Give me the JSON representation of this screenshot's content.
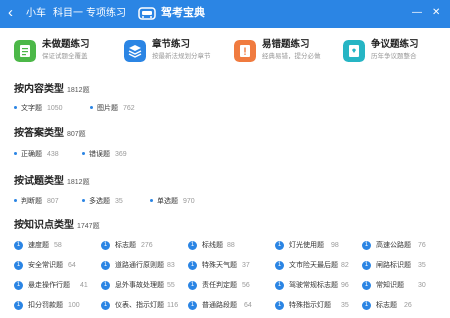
{
  "header": {
    "back_symbol": "‹",
    "crumbs": [
      "小车",
      "科目一",
      "专项练习"
    ],
    "brand": "驾考宝典",
    "window_controls": {
      "minimize": "—",
      "close": "✕"
    },
    "bg_color": "#2b85e4"
  },
  "cards": [
    {
      "title": "未做题练习",
      "subtitle": "保证试题全覆盖",
      "color": "#4cb848",
      "icon": "clipboard-icon"
    },
    {
      "title": "章节练习",
      "subtitle": "按最新法规划分章节",
      "color": "#2b85e4",
      "icon": "layers-icon"
    },
    {
      "title": "易错题练习",
      "subtitle": "经典易错，提分必做",
      "color": "#f07b3f",
      "icon": "warning-clipboard-icon"
    },
    {
      "title": "争议题练习",
      "subtitle": "历年争议题整合",
      "color": "#26b5c4",
      "icon": "dispute-clipboard-icon"
    }
  ],
  "sections": {
    "content": {
      "title": "按内容类型",
      "count": "1812题",
      "items": [
        {
          "label": "文字题",
          "count": "1050"
        },
        {
          "label": "图片题",
          "count": "762"
        }
      ]
    },
    "answer": {
      "title": "按答案类型",
      "count": "807题",
      "items": [
        {
          "label": "正确题",
          "count": "438"
        },
        {
          "label": "错误题",
          "count": "369"
        }
      ]
    },
    "question": {
      "title": "按试题类型",
      "count": "1812题",
      "items": [
        {
          "label": "判断题",
          "count": "807"
        },
        {
          "label": "多选题",
          "count": "35"
        },
        {
          "label": "单选题",
          "count": "970"
        }
      ]
    },
    "knowledge": {
      "title": "按知识点类型",
      "count": "1747题",
      "rows": [
        [
          {
            "num": "1",
            "label": "速度题",
            "count": "58"
          },
          {
            "num": "1",
            "label": "标志题",
            "count": "276"
          },
          {
            "num": "1",
            "label": "标线题",
            "count": "88"
          },
          {
            "num": "1",
            "label": "灯光使用题",
            "count": "98"
          },
          {
            "num": "1",
            "label": "高速公路题",
            "count": "76"
          }
        ],
        [
          {
            "num": "1",
            "label": "安全常识题",
            "count": "64"
          },
          {
            "num": "1",
            "label": "道路通行原则题",
            "count": "83"
          },
          {
            "num": "1",
            "label": "特殊天气题",
            "count": "37"
          },
          {
            "num": "1",
            "label": "文市险天最后题",
            "count": "82"
          },
          {
            "num": "1",
            "label": "闸路标识题",
            "count": "35"
          }
        ],
        [
          {
            "num": "1",
            "label": "悬走操作行题",
            "count": "41"
          },
          {
            "num": "1",
            "label": "息外事故处理题",
            "count": "55"
          },
          {
            "num": "1",
            "label": "责任判定题",
            "count": "56"
          },
          {
            "num": "1",
            "label": "驾驶常规标志题",
            "count": "96"
          },
          {
            "num": "1",
            "label": "常知识题",
            "count": "30"
          }
        ],
        [
          {
            "num": "1",
            "label": "扣分罚款题",
            "count": "100"
          },
          {
            "num": "1",
            "label": "仪表、指示灯题",
            "count": "116"
          },
          {
            "num": "1",
            "label": "普通路段题",
            "count": "64"
          },
          {
            "num": "1",
            "label": "特殊指示灯题",
            "count": "35"
          },
          {
            "num": "1",
            "label": "标志题",
            "count": "26"
          }
        ]
      ]
    }
  }
}
